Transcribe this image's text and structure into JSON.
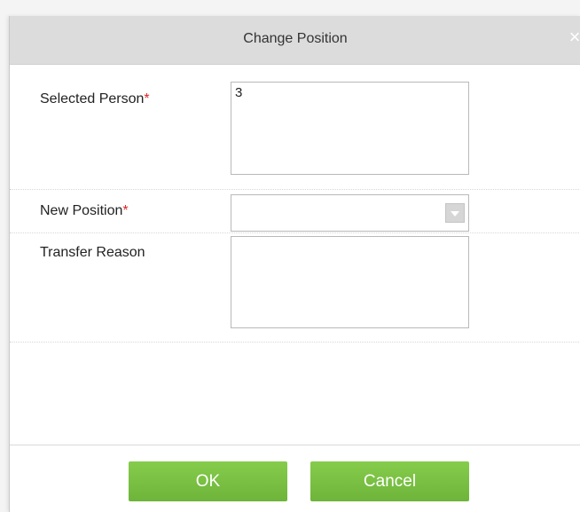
{
  "dialog": {
    "title": "Change Position",
    "close_glyph": "×"
  },
  "form": {
    "selected_person": {
      "label": "Selected Person",
      "required_mark": "*",
      "value": "3"
    },
    "new_position": {
      "label": "New Position",
      "required_mark": "*",
      "value": "",
      "icon": "chevron-down-icon"
    },
    "transfer_reason": {
      "label": "Transfer Reason",
      "value": ""
    }
  },
  "buttons": {
    "ok_label": "OK",
    "cancel_label": "Cancel"
  },
  "colors": {
    "title_bar": "#dcdcdc",
    "button_green": "#7ac143",
    "required_red": "#e02424"
  }
}
